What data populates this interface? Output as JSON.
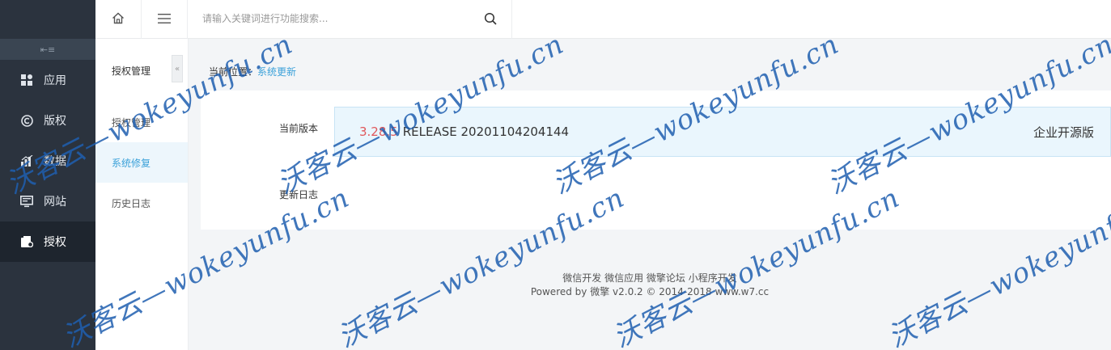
{
  "sidebar": {
    "collapse_icon": "outdent-icon",
    "items": [
      {
        "label": "应用",
        "icon": "apps-icon",
        "active": false
      },
      {
        "label": "版权",
        "icon": "copyright-icon",
        "active": false
      },
      {
        "label": "数据",
        "icon": "bar-chart-icon",
        "active": false
      },
      {
        "label": "网站",
        "icon": "monitor-icon",
        "active": false
      },
      {
        "label": "授权",
        "icon": "license-icon",
        "active": true
      }
    ]
  },
  "topbar": {
    "home_icon": "home-icon",
    "menu_icon": "menu-icon",
    "search_placeholder": "请输入关键词进行功能搜索...",
    "search_icon": "search-icon"
  },
  "subnav": {
    "title": "授权管理",
    "items": [
      {
        "label": "授权管理",
        "active": false
      },
      {
        "label": "系统修复",
        "active": true
      },
      {
        "label": "历史日志",
        "active": false
      }
    ]
  },
  "breadcrumb": {
    "prefix": "当前位置：",
    "current": "系统更新"
  },
  "panel": {
    "version_label": "当前版本",
    "version_number": "3.28.5",
    "version_text": "RELEASE 20201104204144",
    "edition": "企业开源版",
    "changelog_label": "更新日志"
  },
  "footer": {
    "links": "微信开发 微信应用 微擎论坛 小程序开发",
    "copyright": "Powered by 微擎 v2.0.2 © 2014-2018 www.w7.cc"
  },
  "watermark": "沃客云—wokeyunfu.cn",
  "colors": {
    "sidebar_bg": "#2b333e",
    "accent": "#3ba1d9",
    "version_red": "#e0575b",
    "watermark": "#1f5fb0"
  }
}
